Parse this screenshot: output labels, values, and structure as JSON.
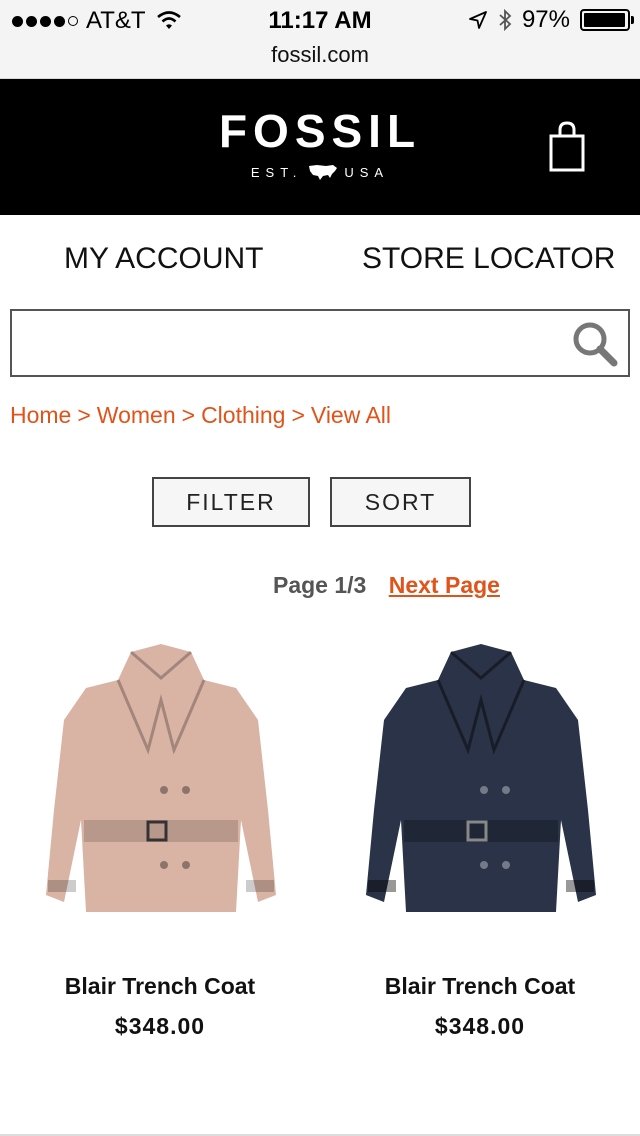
{
  "status_bar": {
    "carrier": "AT&T",
    "time": "11:17 AM",
    "battery": "97%",
    "battery_level": 0.97
  },
  "browser": {
    "url": "fossil.com"
  },
  "header": {
    "brand": "FOSSIL",
    "tagline_left": "EST.",
    "tagline_right": "USA",
    "cart_icon": "shopping-bag-icon"
  },
  "nav": {
    "account": "MY ACCOUNT",
    "store_locator": "STORE LOCATOR"
  },
  "search": {
    "value": "",
    "placeholder": "",
    "icon": "search-icon"
  },
  "breadcrumb": [
    "Home",
    "Women",
    "Clothing",
    "View All"
  ],
  "breadcrumb_separator": ">",
  "controls": {
    "filter": "FILTER",
    "sort": "SORT"
  },
  "pagination": {
    "page_info": "Page 1/3",
    "next": "Next Page"
  },
  "products": [
    {
      "name": "Blair Trench Coat",
      "price": "$348.00",
      "color": "#d9b3a4"
    },
    {
      "name": "Blair Trench Coat",
      "price": "$348.00",
      "color": "#2a3347"
    }
  ],
  "colors": {
    "accent": "#e0531a",
    "header_bg": "#000000"
  }
}
